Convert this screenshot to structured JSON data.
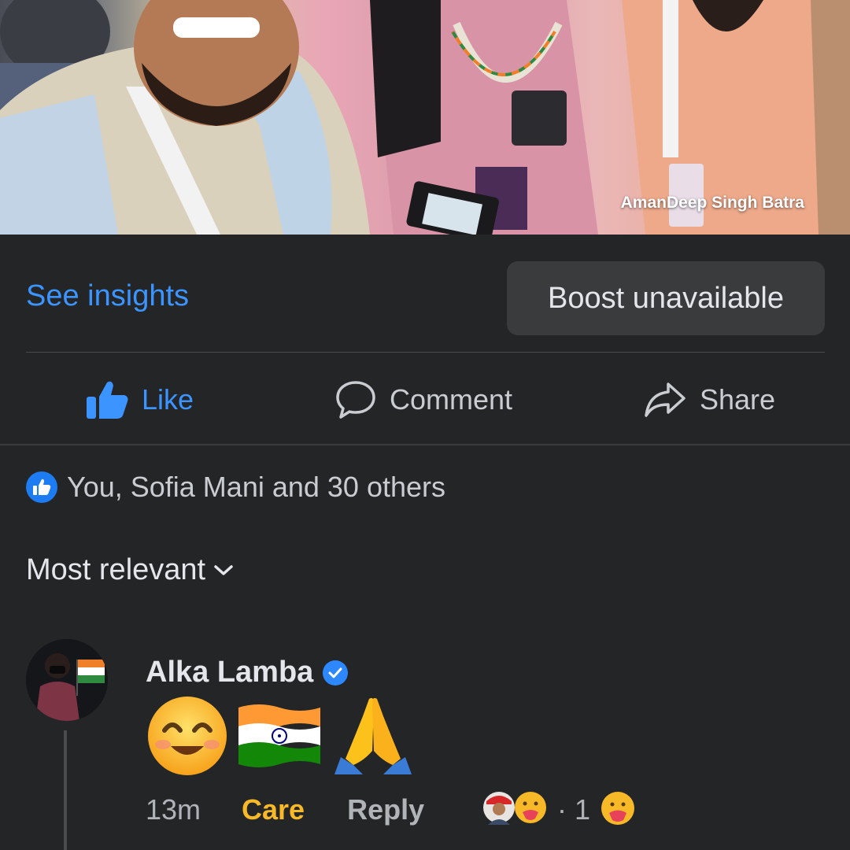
{
  "photo": {
    "watermark": "AmanDeep Singh Batra"
  },
  "post_actions": {
    "insights_label": "See insights",
    "boost_label": "Boost unavailable"
  },
  "action_bar": {
    "like_label": "Like",
    "comment_label": "Comment",
    "share_label": "Share",
    "like_state_color": "#3b94ff"
  },
  "reactions_summary": {
    "text": "You, Sofia Mani and 30 others",
    "icon": "like-icon"
  },
  "comments_filter": {
    "label": "Most relevant",
    "icon": "chevron-down-icon"
  },
  "comment": {
    "author": "Alka Lamba",
    "verified": true,
    "body_emojis": [
      "smiling-face-icon",
      "india-flag-icon",
      "folded-hands-icon"
    ],
    "time": "13m",
    "reaction_label": "Care",
    "reply_label": "Reply",
    "reaction_separator": "·",
    "reaction_count": "1",
    "care_color": "#f7b928"
  }
}
